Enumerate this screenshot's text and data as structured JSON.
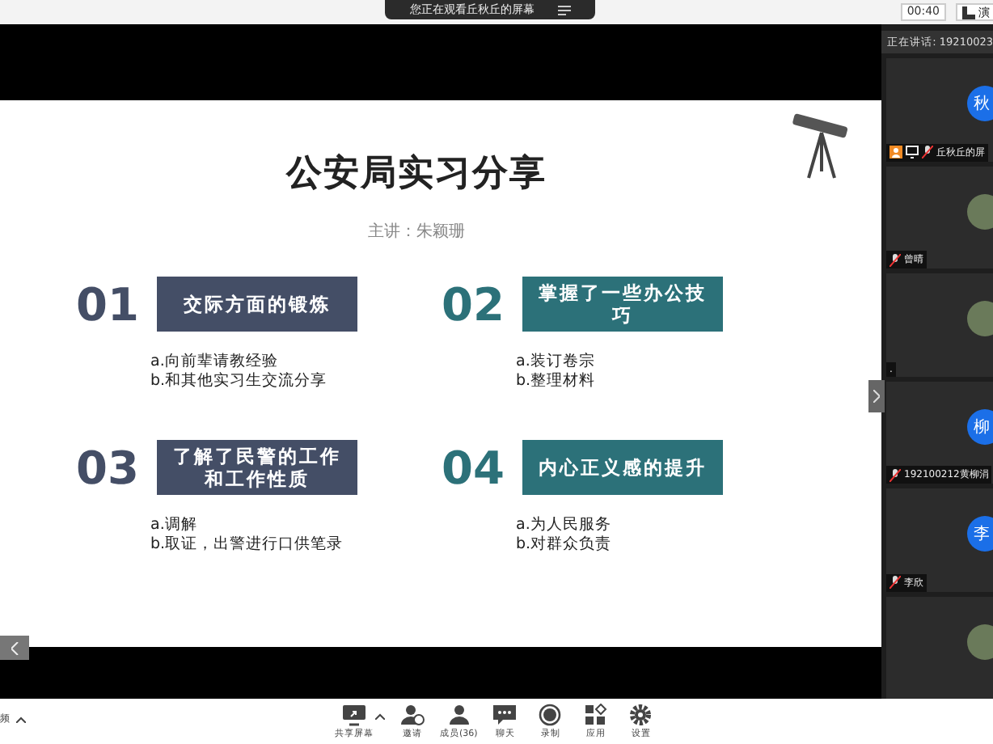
{
  "top_bar": {
    "banner": "您正在观看丘秋丘的屏幕",
    "timer": "00:40",
    "view_button": "演"
  },
  "speaking": {
    "label": "正在讲话: 19210023"
  },
  "slide": {
    "title": "公安局实习分享",
    "presenter": "主讲：朱颖珊",
    "sections": [
      {
        "number": "01",
        "heading": "交际方面的锻炼",
        "color": "#444e66",
        "points": [
          "a.向前辈请教经验",
          "b.和其他实习生交流分享"
        ]
      },
      {
        "number": "02",
        "heading": "掌握了一些办公技巧",
        "color": "#2c7179",
        "points": [
          "a.装订卷宗",
          "b.整理材料"
        ]
      },
      {
        "number": "03",
        "heading": "了解了民警的工作和工作性质",
        "color": "#444e66",
        "points": [
          "a.调解",
          "b.取证，出警进行口供笔录"
        ]
      },
      {
        "number": "04",
        "heading": "内心正义感的提升",
        "color": "#2c7179",
        "points": [
          "a.为人民服务",
          "b.对群众负责"
        ]
      }
    ]
  },
  "participants": [
    {
      "kind": "initial",
      "avatar_text": "秋",
      "name": "丘秋丘的屏",
      "host": true,
      "sharing": true,
      "muted": true
    },
    {
      "kind": "photo",
      "name": "曾晴",
      "host": false,
      "sharing": false,
      "muted": true
    },
    {
      "kind": "photo",
      "name": ".",
      "host": false,
      "sharing": false,
      "muted": false
    },
    {
      "kind": "initial",
      "avatar_text": "柳",
      "name": "192100212黄柳涓",
      "host": false,
      "sharing": false,
      "muted": true
    },
    {
      "kind": "initial",
      "avatar_text": "李",
      "name": "李欣",
      "host": false,
      "sharing": false,
      "muted": true
    },
    {
      "kind": "photo",
      "host": false,
      "sharing": false,
      "muted": false
    }
  ],
  "toolbar": {
    "left_label": "频",
    "items": [
      {
        "kind": "share",
        "label": "共享屏幕",
        "caret": true
      },
      {
        "kind": "invite",
        "label": "邀请",
        "caret": false
      },
      {
        "kind": "members",
        "label": "成员(36)",
        "caret": false
      },
      {
        "kind": "chat",
        "label": "聊天",
        "caret": false
      },
      {
        "kind": "record",
        "label": "录制",
        "caret": false
      },
      {
        "kind": "apps",
        "label": "应用",
        "caret": false
      },
      {
        "kind": "settings",
        "label": "设置",
        "caret": false
      }
    ]
  }
}
